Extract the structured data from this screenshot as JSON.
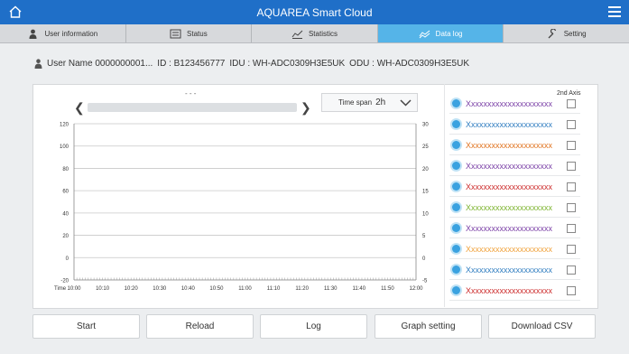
{
  "app": {
    "title": "AQUAREA Smart Cloud"
  },
  "tabs": [
    {
      "label": "User information",
      "icon": "user-icon"
    },
    {
      "label": "Status",
      "icon": "status-icon"
    },
    {
      "label": "Statistics",
      "icon": "statistics-icon"
    },
    {
      "label": "Data log",
      "icon": "data-log-icon",
      "active": true
    },
    {
      "label": "Setting",
      "icon": "wrench-icon"
    }
  ],
  "user": {
    "name": "User Name 0000000001...",
    "id": "ID : B123456777",
    "idu": "IDU : WH-ADC0309H3E5UK",
    "odu": "ODU : WH-ADC0309H3E5UK"
  },
  "graph": {
    "range_label": "- - -",
    "timespan_label": "Time span",
    "timespan_value": "2h",
    "second_axis_label": "2nd Axis",
    "time_axis_label": "Time",
    "colors": {
      "axis": "#888888",
      "grid": "#c8c8c8",
      "tab_active": "#55b4e8",
      "header": "#1f6fc8"
    }
  },
  "legend": [
    {
      "name": "Xxxxxxxxxxxxxxxxxxxxx",
      "color": "#7a3fa6",
      "checked": false
    },
    {
      "name": "Xxxxxxxxxxxxxxxxxxxxx",
      "color": "#2f7dc0",
      "checked": false
    },
    {
      "name": "Xxxxxxxxxxxxxxxxxxxxx",
      "color": "#e0731f",
      "checked": false
    },
    {
      "name": "Xxxxxxxxxxxxxxxxxxxxx",
      "color": "#7a3fa6",
      "checked": false
    },
    {
      "name": "Xxxxxxxxxxxxxxxxxxxxx",
      "color": "#cc2a2a",
      "checked": false
    },
    {
      "name": "Xxxxxxxxxxxxxxxxxxxxx",
      "color": "#7cb32e",
      "checked": false
    },
    {
      "name": "Xxxxxxxxxxxxxxxxxxxxx",
      "color": "#7a3fa6",
      "checked": false
    },
    {
      "name": "Xxxxxxxxxxxxxxxxxxxxx",
      "color": "#f0a23c",
      "checked": false
    },
    {
      "name": "Xxxxxxxxxxxxxxxxxxxxx",
      "color": "#2f7dc0",
      "checked": false
    },
    {
      "name": "Xxxxxxxxxxxxxxxxxxxxx",
      "color": "#cc2a2a",
      "checked": false
    }
  ],
  "chart_data": {
    "type": "line",
    "title": "",
    "xlabel": "Time",
    "ylabel": "",
    "x": [
      "10:00",
      "10:10",
      "10:20",
      "10:30",
      "10:40",
      "10:50",
      "11:00",
      "11:10",
      "11:20",
      "11:30",
      "11:40",
      "11:50",
      "12:00"
    ],
    "y_ticks": [
      120,
      100,
      80,
      60,
      40,
      20,
      0,
      -20
    ],
    "y2_ticks": [
      30,
      25,
      20,
      15,
      10,
      5,
      0,
      -5
    ],
    "ylim": [
      -20,
      120
    ],
    "y2lim": [
      -5,
      30
    ],
    "grid": true,
    "series": []
  },
  "buttons": {
    "start": "Start",
    "reload": "Reload",
    "log": "Log",
    "graph_setting": "Graph setting",
    "download_csv": "Download CSV"
  }
}
